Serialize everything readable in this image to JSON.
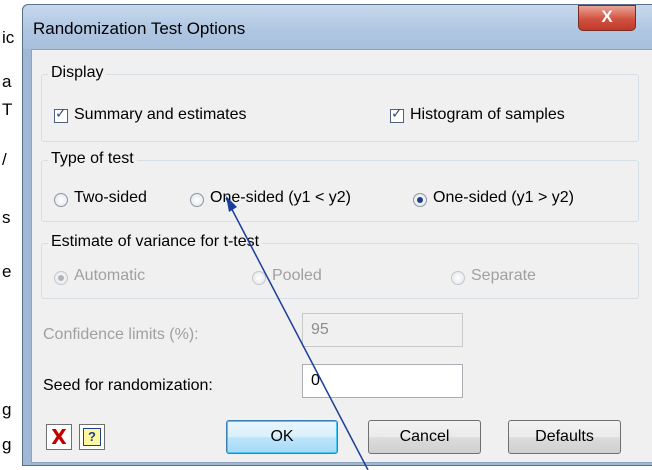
{
  "background": {
    "fragments": [
      "ic",
      "a",
      "T",
      "/",
      "s",
      "e",
      "g",
      "g"
    ]
  },
  "dialog": {
    "title": "Randomization Test Options",
    "close_label": "X"
  },
  "display": {
    "label": "Display",
    "summary_label": "Summary and estimates",
    "histogram_label": "Histogram of samples"
  },
  "test_type": {
    "label": "Type of test",
    "options": [
      "Two-sided",
      "One-sided (y1 < y2)",
      "One-sided (y1 > y2)"
    ],
    "selected": "One-sided (y1 > y2)"
  },
  "variance": {
    "label": "Estimate of variance for t-test",
    "options": [
      "Automatic",
      "Pooled",
      "Separate"
    ],
    "selected": "Automatic"
  },
  "confidence": {
    "label": "Confidence limits (%):",
    "value": "95"
  },
  "seed": {
    "label": "Seed for randomization:",
    "value": "0"
  },
  "buttons": {
    "ok": "OK",
    "cancel": "Cancel",
    "defaults": "Defaults",
    "help": "?",
    "clear": "X"
  },
  "colors": {
    "accent": "#1e3f8a",
    "clear_icon": "#c00000",
    "annotation_arrow": "#1a3f99"
  }
}
